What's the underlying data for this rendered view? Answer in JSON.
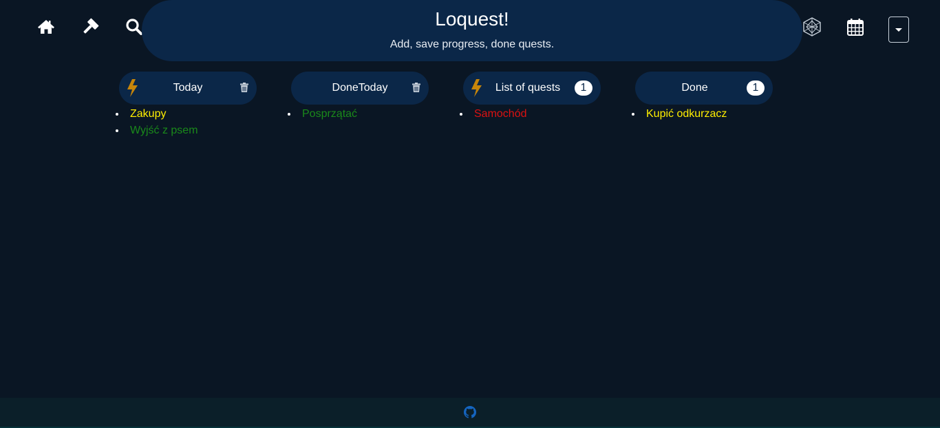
{
  "app": {
    "title": "Loquest!",
    "subtitle": "Add, save progress, done quests."
  },
  "nav": {
    "left_icons": [
      "home-icon",
      "hammer-icon",
      "search-icon"
    ],
    "right_icons": [
      "graph-icon",
      "calendar-icon"
    ],
    "dropdown": "dropdown-toggle"
  },
  "columns": [
    {
      "title": "Today",
      "has_bolt": true,
      "has_trash": true,
      "badge": null,
      "items": [
        {
          "text": "Zakupy",
          "color": "#ffee00"
        },
        {
          "text": "Wyjść z psem",
          "color": "#1a8a1a"
        }
      ]
    },
    {
      "title": "DoneToday",
      "has_bolt": false,
      "has_trash": true,
      "badge": null,
      "items": [
        {
          "text": "Posprzątać",
          "color": "#1a8a1a"
        }
      ]
    },
    {
      "title": "List of quests",
      "has_bolt": true,
      "has_trash": false,
      "badge": "1",
      "items": [
        {
          "text": "Samochód",
          "color": "#dd1111"
        }
      ]
    },
    {
      "title": "Done",
      "has_bolt": false,
      "has_trash": false,
      "badge": "1",
      "items": [
        {
          "text": "Kupić odkurzacz",
          "color": "#ffee00"
        }
      ]
    }
  ],
  "footer": {
    "icon": "github-icon",
    "icon_color": "#1565c0"
  },
  "colors": {
    "background": "#0a1624",
    "panel": "#0b2748",
    "bolt": "#c8860a"
  }
}
